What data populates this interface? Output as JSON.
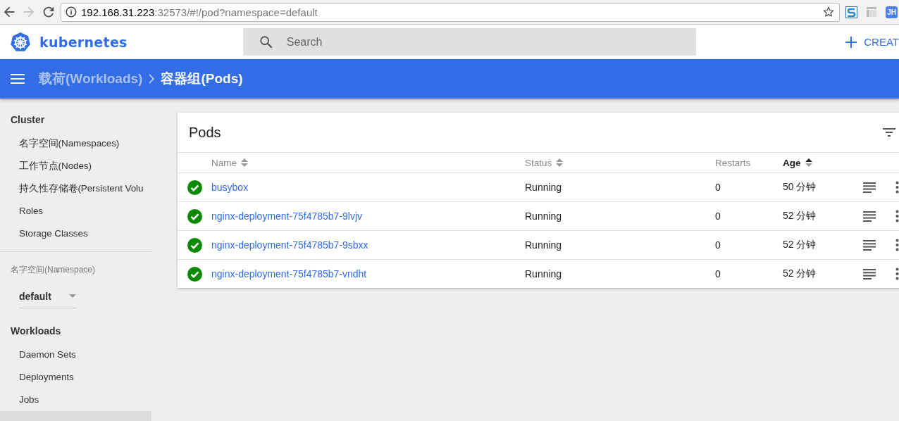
{
  "browser": {
    "url_host": "192.168.31.223",
    "url_path": ":32573/#!/pod?namespace=default",
    "forward_disabled": true,
    "extension_badge": "JH"
  },
  "header": {
    "brand": "kubernetes",
    "search": {
      "placeholder": "Search"
    },
    "create": "CREAT"
  },
  "breadcrumbs": [
    {
      "label": "载荷(Workloads)",
      "current": false
    },
    {
      "label": "容器组(Pods)",
      "current": true
    }
  ],
  "sidebar": {
    "sections": [
      {
        "title": "Cluster",
        "items": [
          {
            "label": "名字空间(Namespaces)",
            "selected": false
          },
          {
            "label": "工作节点(Nodes)",
            "selected": false
          },
          {
            "label": "持久性存储卷(Persistent Volu",
            "selected": false
          },
          {
            "label": "Roles",
            "selected": false
          },
          {
            "label": "Storage Classes",
            "selected": false
          }
        ]
      },
      {
        "title": "Workloads",
        "items": [
          {
            "label": "Daemon Sets",
            "selected": false
          },
          {
            "label": "Deployments",
            "selected": false
          },
          {
            "label": "Jobs",
            "selected": false
          },
          {
            "selected": true
          }
        ]
      }
    ],
    "namespace": {
      "label": "名字空间(Namespace)",
      "value": "default"
    }
  },
  "pods": {
    "title": "Pods",
    "columns": [
      {
        "label": "Name",
        "sortable": true,
        "sorted_ascending": false
      },
      {
        "label": "Status",
        "sortable": true,
        "sorted_ascending": false
      },
      {
        "label": "Restarts",
        "sortable": false,
        "sorted_ascending": false
      },
      {
        "label": "Age",
        "sortable": true,
        "sorted_ascending": true
      }
    ],
    "rows": [
      {
        "healthy": true,
        "name": "busybox",
        "status": "Running",
        "restarts": "0",
        "age": "50 分钟"
      },
      {
        "healthy": true,
        "name": "nginx-deployment-75f4785b7-9lvjv",
        "status": "Running",
        "restarts": "0",
        "age": "52 分钟"
      },
      {
        "healthy": true,
        "name": "nginx-deployment-75f4785b7-9sbxx",
        "status": "Running",
        "restarts": "0",
        "age": "52 分钟"
      },
      {
        "healthy": true,
        "name": "nginx-deployment-75f4785b7-vndht",
        "status": "Running",
        "restarts": "0",
        "age": "52 分钟"
      }
    ]
  }
}
